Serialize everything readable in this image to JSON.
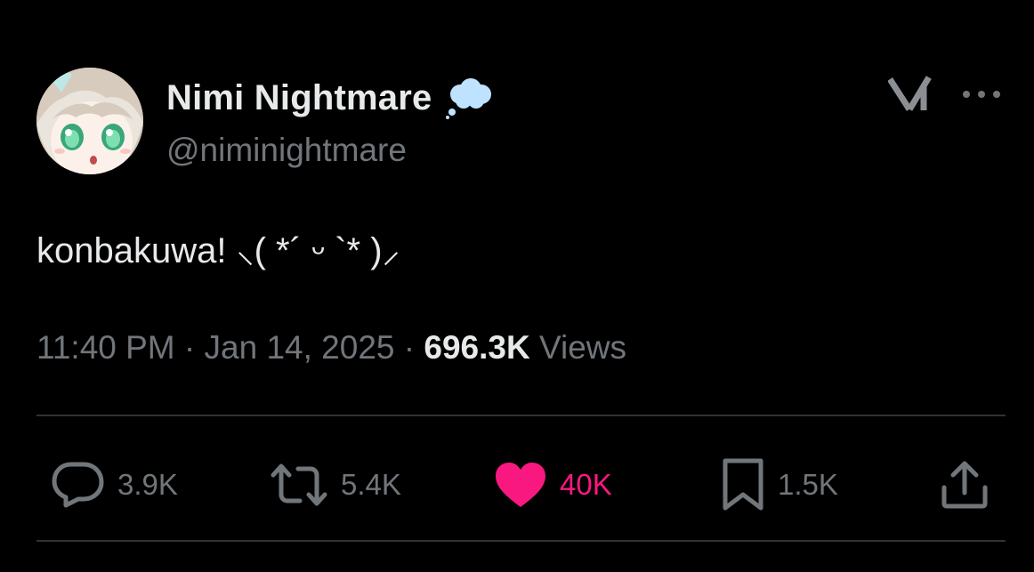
{
  "author": {
    "display_name": "Nimi Nightmare",
    "handle": "@niminightmare",
    "badge_icon": "thought-bubble-icon",
    "avatar": "avatar-image"
  },
  "header_actions": {
    "grok_icon": "grok-icon",
    "more_icon": "more-horizontal-icon"
  },
  "tweet": {
    "text": "konbakuwa! ⸜( *´ ᵕ `* )⸝"
  },
  "meta": {
    "time": "11:40 PM",
    "separator": " · ",
    "date": "Jan 14, 2025",
    "views_count": "696.3K",
    "views_label": "Views"
  },
  "actions": {
    "reply": {
      "icon": "reply-icon",
      "count": "3.9K"
    },
    "retweet": {
      "icon": "retweet-icon",
      "count": "5.4K"
    },
    "like": {
      "icon": "heart-icon",
      "count": "40K",
      "active": true
    },
    "bookmark": {
      "icon": "bookmark-icon",
      "count": "1.5K"
    },
    "share": {
      "icon": "share-icon"
    }
  },
  "colors": {
    "background": "#000000",
    "primary_text": "#e7e9ea",
    "secondary_text": "#71767b",
    "divider": "#2f3336",
    "like_active": "#f91880",
    "badge": "#bfe3ff"
  }
}
